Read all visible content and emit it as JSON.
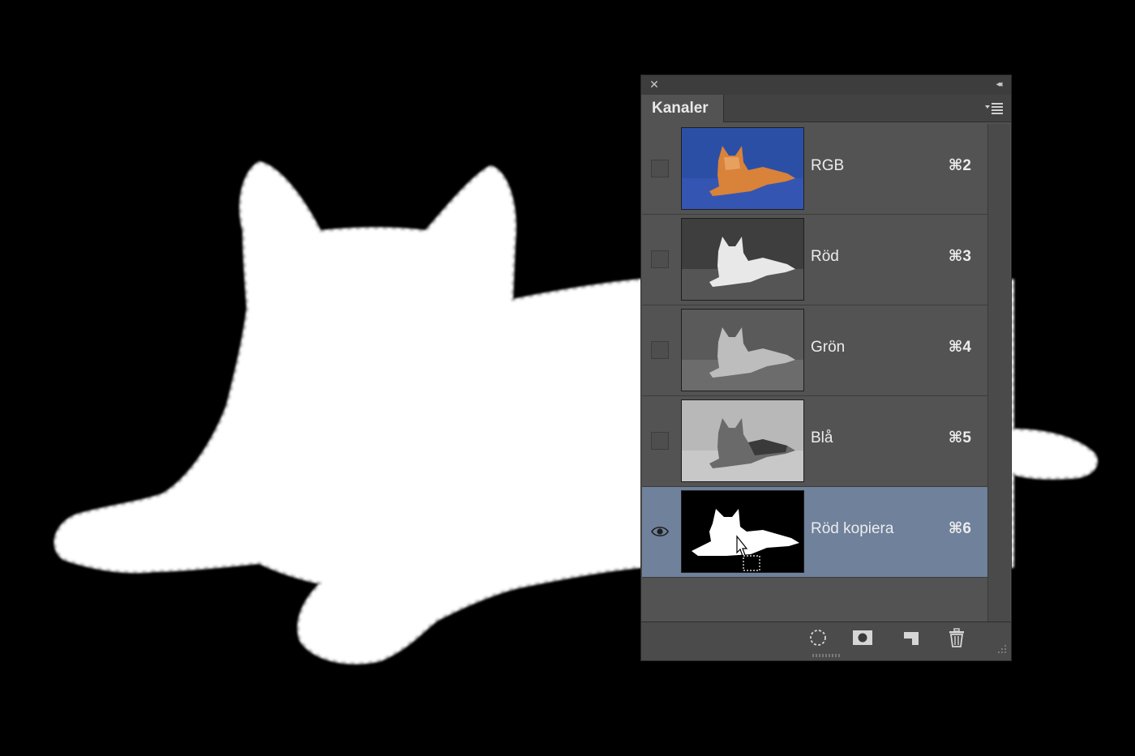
{
  "panel": {
    "tab_label": "Kanaler",
    "close_icon": "close-icon",
    "collapse_icon": "double-chevron-left-icon",
    "menu_icon": "panel-menu-icon"
  },
  "channels": [
    {
      "name": "RGB",
      "shortcut": "⌘2",
      "visible": false,
      "selected": false,
      "thumb": "color"
    },
    {
      "name": "Röd",
      "shortcut": "⌘3",
      "visible": false,
      "selected": false,
      "thumb": "red"
    },
    {
      "name": "Grön",
      "shortcut": "⌘4",
      "visible": false,
      "selected": false,
      "thumb": "green"
    },
    {
      "name": "Blå",
      "shortcut": "⌘5",
      "visible": false,
      "selected": false,
      "thumb": "blue"
    },
    {
      "name": "Röd kopiera",
      "shortcut": "⌘6",
      "visible": true,
      "selected": true,
      "thumb": "mask"
    }
  ],
  "footer": {
    "buttons": [
      {
        "name": "load-selection-icon"
      },
      {
        "name": "save-selection-icon"
      },
      {
        "name": "new-channel-icon"
      },
      {
        "name": "trash-icon"
      }
    ]
  },
  "colors": {
    "panel_bg": "#535353",
    "selected_row": "#6f819b",
    "canvas_bg": "#000000",
    "mask_white": "#ffffff"
  }
}
